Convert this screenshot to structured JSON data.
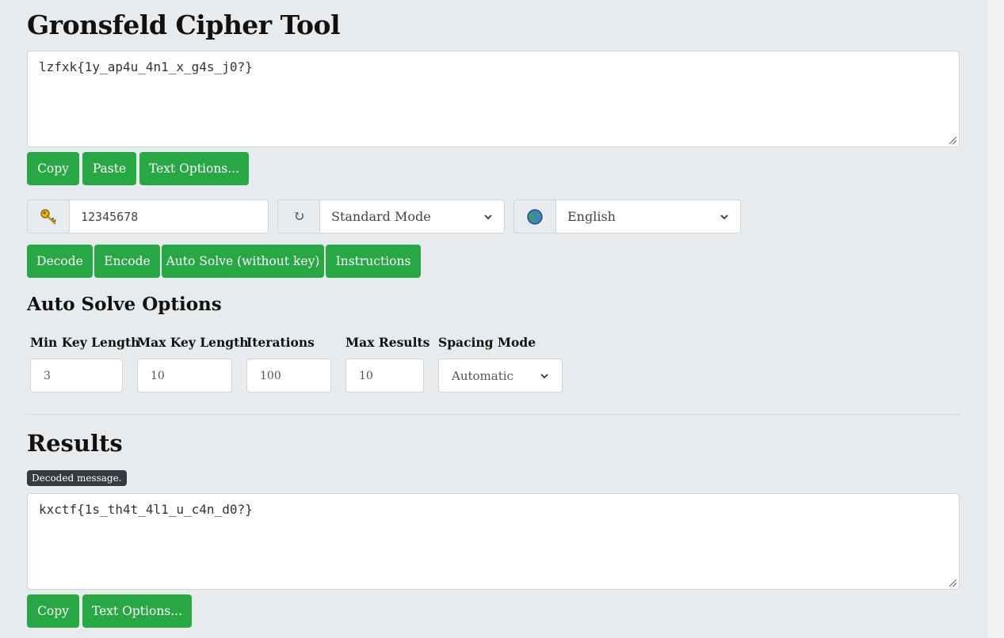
{
  "title": "Gronsfeld Cipher Tool",
  "input": {
    "text": "lzfxk{1y_ap4u_4n1_x_g4s_j0?}",
    "buttons": {
      "copy": "Copy",
      "paste": "Paste",
      "text_options": "Text Options..."
    }
  },
  "settings": {
    "key": {
      "icon": "key-icon",
      "value": "12345678"
    },
    "mode": {
      "icon": "refresh-icon",
      "selected": "Standard Mode"
    },
    "language": {
      "icon": "globe-icon",
      "selected": "English"
    }
  },
  "actions": {
    "decode": "Decode",
    "encode": "Encode",
    "auto_solve": "Auto Solve (without key)",
    "instructions": "Instructions"
  },
  "auto_solve": {
    "heading": "Auto Solve Options",
    "min_key_length": {
      "label": "Min Key Length",
      "value": "3"
    },
    "max_key_length": {
      "label": "Max Key Length",
      "value": "10"
    },
    "iterations": {
      "label": "Iterations",
      "value": "100"
    },
    "max_results": {
      "label": "Max Results",
      "value": "10"
    },
    "spacing_mode": {
      "label": "Spacing Mode",
      "selected": "Automatic"
    }
  },
  "results": {
    "heading": "Results",
    "badge": "Decoded message.",
    "text": "kxctf{1s_th4t_4l1_u_c4n_d0?}",
    "buttons": {
      "copy": "Copy",
      "text_options": "Text Options..."
    }
  },
  "colors": {
    "background": "#e8ebee",
    "button_green": "#28a745",
    "badge_dark": "#343a40"
  }
}
